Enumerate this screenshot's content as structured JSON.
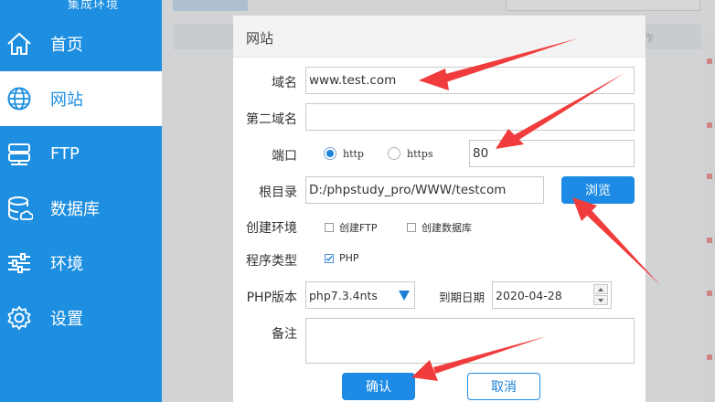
{
  "sidebar": {
    "brand": "集成环境",
    "items": [
      {
        "label": "首页",
        "icon": "home-icon"
      },
      {
        "label": "网站",
        "icon": "globe-icon"
      },
      {
        "label": "FTP",
        "icon": "server-icon"
      },
      {
        "label": "数据库",
        "icon": "database-icon"
      },
      {
        "label": "环境",
        "icon": "sliders-icon"
      },
      {
        "label": "设置",
        "icon": "gear-icon"
      }
    ],
    "active_index": 1
  },
  "background": {
    "table_header_fragment": "作"
  },
  "dialog": {
    "title": "网站",
    "domain": {
      "label": "域名",
      "value": "www.test.com"
    },
    "second_domain": {
      "label": "第二域名",
      "value": ""
    },
    "port": {
      "label": "端口",
      "options": [
        {
          "label": "http",
          "checked": true
        },
        {
          "label": "https",
          "checked": false
        }
      ],
      "value": "80"
    },
    "root_dir": {
      "label": "根目录",
      "value": "D:/phpstudy_pro/WWW/testcom",
      "browse_label": "浏览"
    },
    "create_env": {
      "label": "创建环境",
      "options": [
        {
          "label": "创建FTP",
          "checked": false
        },
        {
          "label": "创建数据库",
          "checked": false
        }
      ]
    },
    "program_type": {
      "label": "程序类型",
      "options": [
        {
          "label": "PHP",
          "checked": true
        }
      ]
    },
    "php_version": {
      "label": "PHP版本",
      "value": "php7.3.4nts"
    },
    "expiry": {
      "label": "到期日期",
      "value": "2020-04-28"
    },
    "remark": {
      "label": "备注",
      "value": ""
    },
    "confirm_label": "确认",
    "cancel_label": "取消"
  },
  "colors": {
    "sidebar": "#1e8fe0",
    "accent": "#1d8be5",
    "annotation_arrow": "#f03c3c"
  }
}
